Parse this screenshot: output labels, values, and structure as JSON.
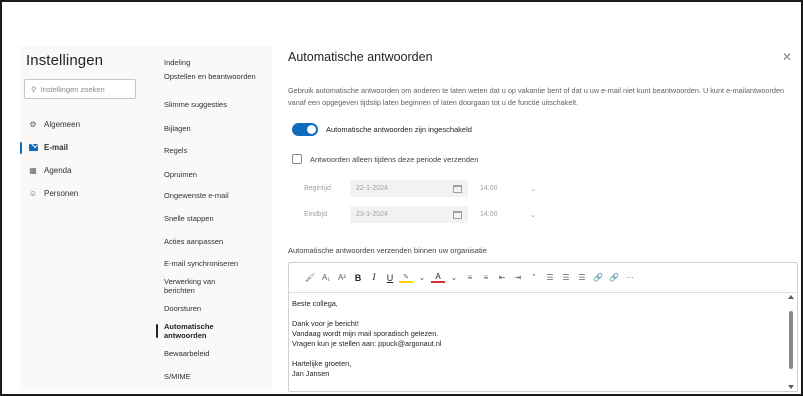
{
  "settings": {
    "title": "Instellingen",
    "search_placeholder": "Instellingen zoeken",
    "categories": [
      {
        "label": "Algemeen",
        "icon": "gear-icon",
        "active": false
      },
      {
        "label": "E-mail",
        "icon": "mail-icon",
        "active": true
      },
      {
        "label": "Agenda",
        "icon": "calendar-icon",
        "active": false
      },
      {
        "label": "Personen",
        "icon": "people-icon",
        "active": false
      }
    ]
  },
  "mail_menu": {
    "items": [
      "Indeling",
      "Opstellen en beantwoorden",
      "Slimme suggesties",
      "Bijlagen",
      "Regels",
      "Opruimen",
      "Ongewenste e-mail",
      "Snelle stappen",
      "Acties aanpassen",
      "E-mail synchroniseren",
      "Verwerking van berichten",
      "Doorsturen",
      "Automatische antwoorden",
      "Bewaarbeleid",
      "S/MIME"
    ],
    "active": "Automatische antwoorden"
  },
  "panel": {
    "title": "Automatische antwoorden",
    "description": "Gebruik automatische antwoorden om anderen te laten weten dat u op vakantie bent of dat u uw e-mail niet kunt beantwoorden. U kunt e-mailantwoorden vanaf een opgegeven tijdstip laten beginnen of laten doorgaan tot u de functie uitschakelt.",
    "toggle_label": "Automatische antwoorden zijn ingeschakeld",
    "toggle_on": true,
    "period_label": "Antwoorden alleen tijdens deze periode verzenden",
    "period_checked": false,
    "start_label": "Begintijd",
    "start_date": "22-1-2024",
    "start_time": "14:00",
    "end_label": "Eindtijd",
    "end_date": "23-1-2024",
    "end_time": "14:00",
    "section_label": "Automatische antwoorden verzenden binnen uw organisatie",
    "message_lines": [
      "Beste collega,",
      "",
      "Dank voor je bericht!",
      "Vandaag wordt mijn mail sporadisch gelezen.",
      "Vragen kun je stellen aan: ppuck@argonaut.nl",
      "",
      "Hartelijke groeten,",
      "Jan Jansen"
    ]
  },
  "colors": {
    "accent": "#0f6cbd",
    "highlight": "#ffd400",
    "font_color": "#d13438"
  }
}
